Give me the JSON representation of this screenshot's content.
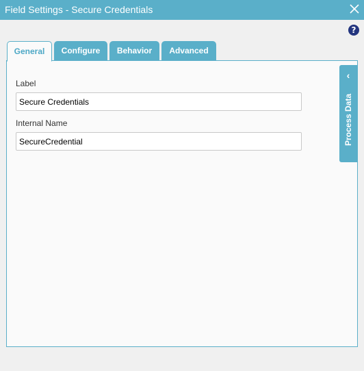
{
  "dialog": {
    "title": "Field Settings - Secure Credentials",
    "close_icon": "close-icon",
    "help_icon": "help-icon",
    "help_glyph": "?"
  },
  "tabs": [
    {
      "label": "General",
      "active": true
    },
    {
      "label": "Configure",
      "active": false
    },
    {
      "label": "Behavior",
      "active": false
    },
    {
      "label": "Advanced",
      "active": false
    }
  ],
  "general": {
    "label_field": {
      "label": "Label",
      "value": "Secure Credentials"
    },
    "internal_name_field": {
      "label": "Internal Name",
      "value": "SecureCredential"
    }
  },
  "process_data": {
    "label": "Process Data",
    "chevron_icon": "chevron-left-icon",
    "chevron_glyph": "‹"
  },
  "colors": {
    "accent": "#5aafc9",
    "active_tab_text": "#4da8c6",
    "help_icon_bg": "#23357f",
    "panel_bg": "#fafafa"
  }
}
